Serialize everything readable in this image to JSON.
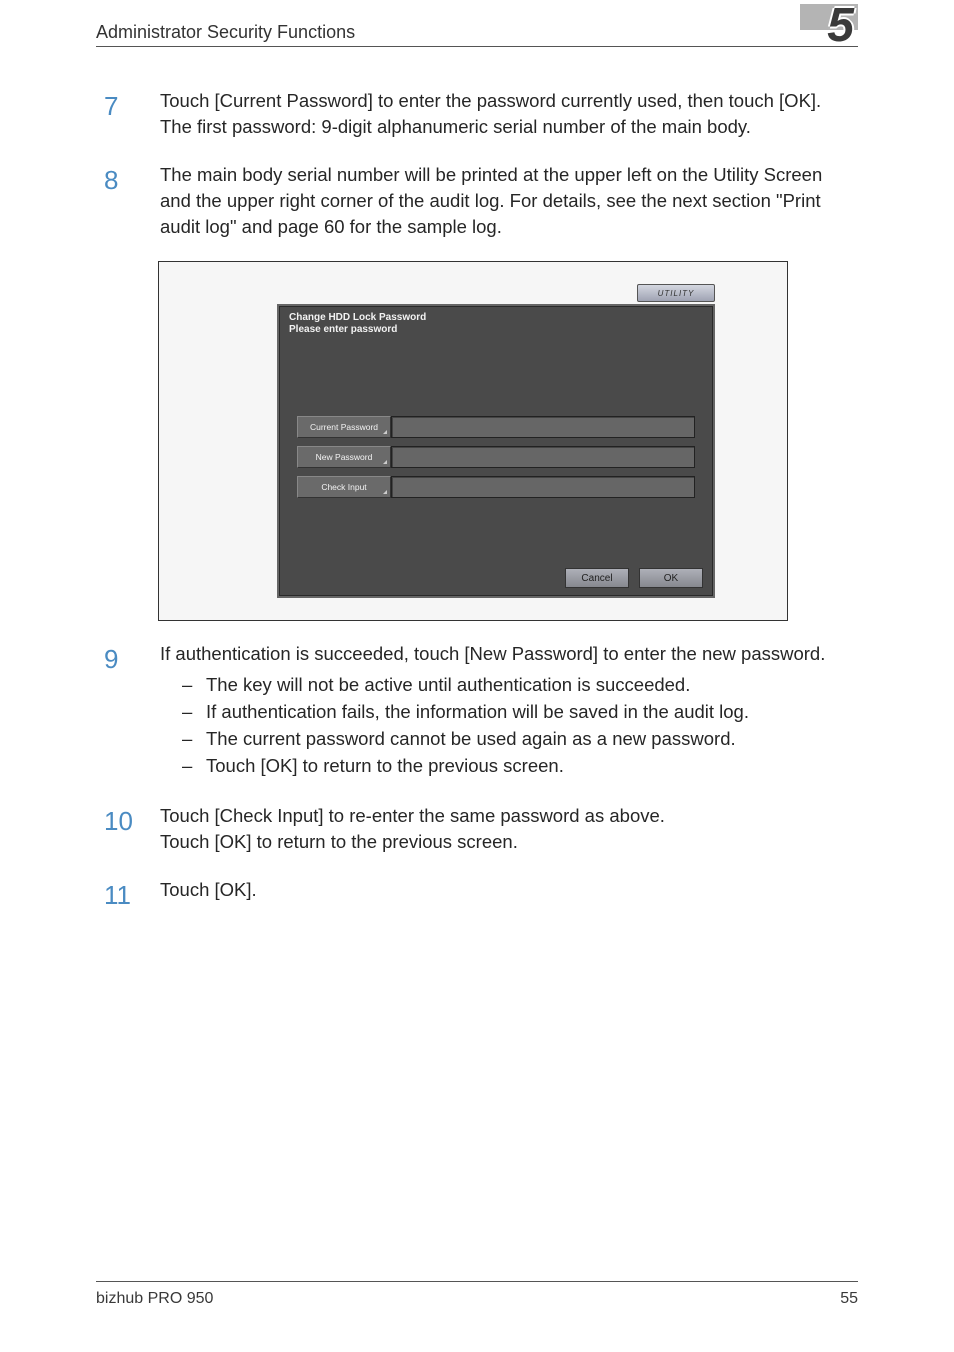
{
  "header": {
    "title": "Administrator Security Functions",
    "chapter_number": "5"
  },
  "steps": {
    "s7": {
      "num": "7",
      "line1": "Touch [Current Password] to enter the password currently used, then touch [OK].",
      "line2": "The first password: 9-digit alphanumeric serial number of the main body."
    },
    "s8": {
      "num": "8",
      "text": "The main body serial number will be printed at the upper left on the Utility Screen and the upper right corner of the audit log. For details, see the next section \"Print audit log\" and page 60 for the sample log."
    },
    "s9": {
      "num": "9",
      "intro": "If authentication is succeeded, touch [New Password] to enter the new password.",
      "bullets": [
        "The key will not be active until authentication is succeeded.",
        "If authentication fails, the information will be saved in the audit log.",
        "The current password cannot be used again as a new password.",
        "Touch [OK] to return to the previous screen."
      ]
    },
    "s10": {
      "num": "10",
      "line1": "Touch [Check Input] to re-enter the same password as above.",
      "line2": "Touch [OK] to return to the previous screen."
    },
    "s11": {
      "num": "11",
      "text": "Touch [OK]."
    }
  },
  "screen": {
    "utility_label": "UTILITY",
    "header_line1": "Change HDD Lock Password",
    "header_line2": "Please enter password",
    "fields": {
      "current": "Current Password",
      "new": "New Password",
      "check": "Check Input"
    },
    "footer": {
      "cancel": "Cancel",
      "ok": "OK"
    }
  },
  "footer": {
    "product": "bizhub PRO 950",
    "page": "55"
  }
}
